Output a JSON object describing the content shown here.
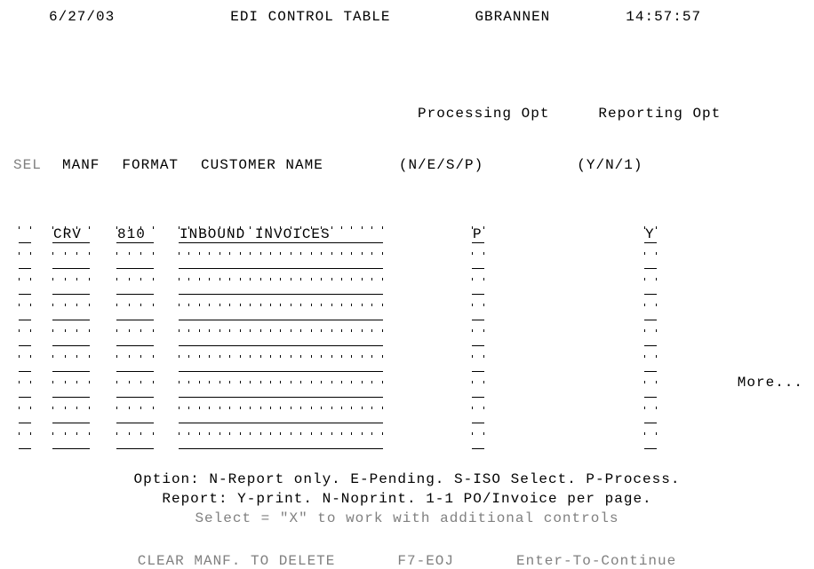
{
  "header": {
    "date": "6/27/03",
    "title": "EDI CONTROL TABLE",
    "user": "GBRANNEN",
    "time": "14:57:57"
  },
  "columns": {
    "sel": "SEL",
    "manf": "MANF",
    "format": "FORMAT",
    "customer": "CUSTOMER NAME",
    "processing1": "Processing Opt",
    "processing2": "(N/E/S/P)",
    "reporting1": "Reporting Opt",
    "reporting2": "(Y/N/1)"
  },
  "rows": [
    {
      "sel": "",
      "manf": "CRV",
      "format": "810",
      "customer": "INBOUND INVOICES",
      "proc": "P",
      "rep": "Y"
    },
    {
      "sel": "",
      "manf": "",
      "format": "",
      "customer": "",
      "proc": "",
      "rep": ""
    },
    {
      "sel": "",
      "manf": "",
      "format": "",
      "customer": "",
      "proc": "",
      "rep": ""
    },
    {
      "sel": "",
      "manf": "",
      "format": "",
      "customer": "",
      "proc": "",
      "rep": ""
    },
    {
      "sel": "",
      "manf": "",
      "format": "",
      "customer": "",
      "proc": "",
      "rep": ""
    },
    {
      "sel": "",
      "manf": "",
      "format": "",
      "customer": "",
      "proc": "",
      "rep": ""
    },
    {
      "sel": "",
      "manf": "",
      "format": "",
      "customer": "",
      "proc": "",
      "rep": ""
    },
    {
      "sel": "",
      "manf": "",
      "format": "",
      "customer": "",
      "proc": "",
      "rep": ""
    },
    {
      "sel": "",
      "manf": "",
      "format": "",
      "customer": "",
      "proc": "",
      "rep": ""
    }
  ],
  "more": "More...",
  "footer": {
    "line1": "Option: N-Report only. E-Pending. S-ISO Select. P-Process.",
    "line2": "Report: Y-print. N-Noprint. 1-1 PO/Invoice per page.",
    "line3": "Select = \"X\" to work with additional controls"
  },
  "fnkeys": {
    "clear": "CLEAR MANF. TO DELETE",
    "f7": "F7-EOJ",
    "enter": "Enter-To-Continue"
  }
}
